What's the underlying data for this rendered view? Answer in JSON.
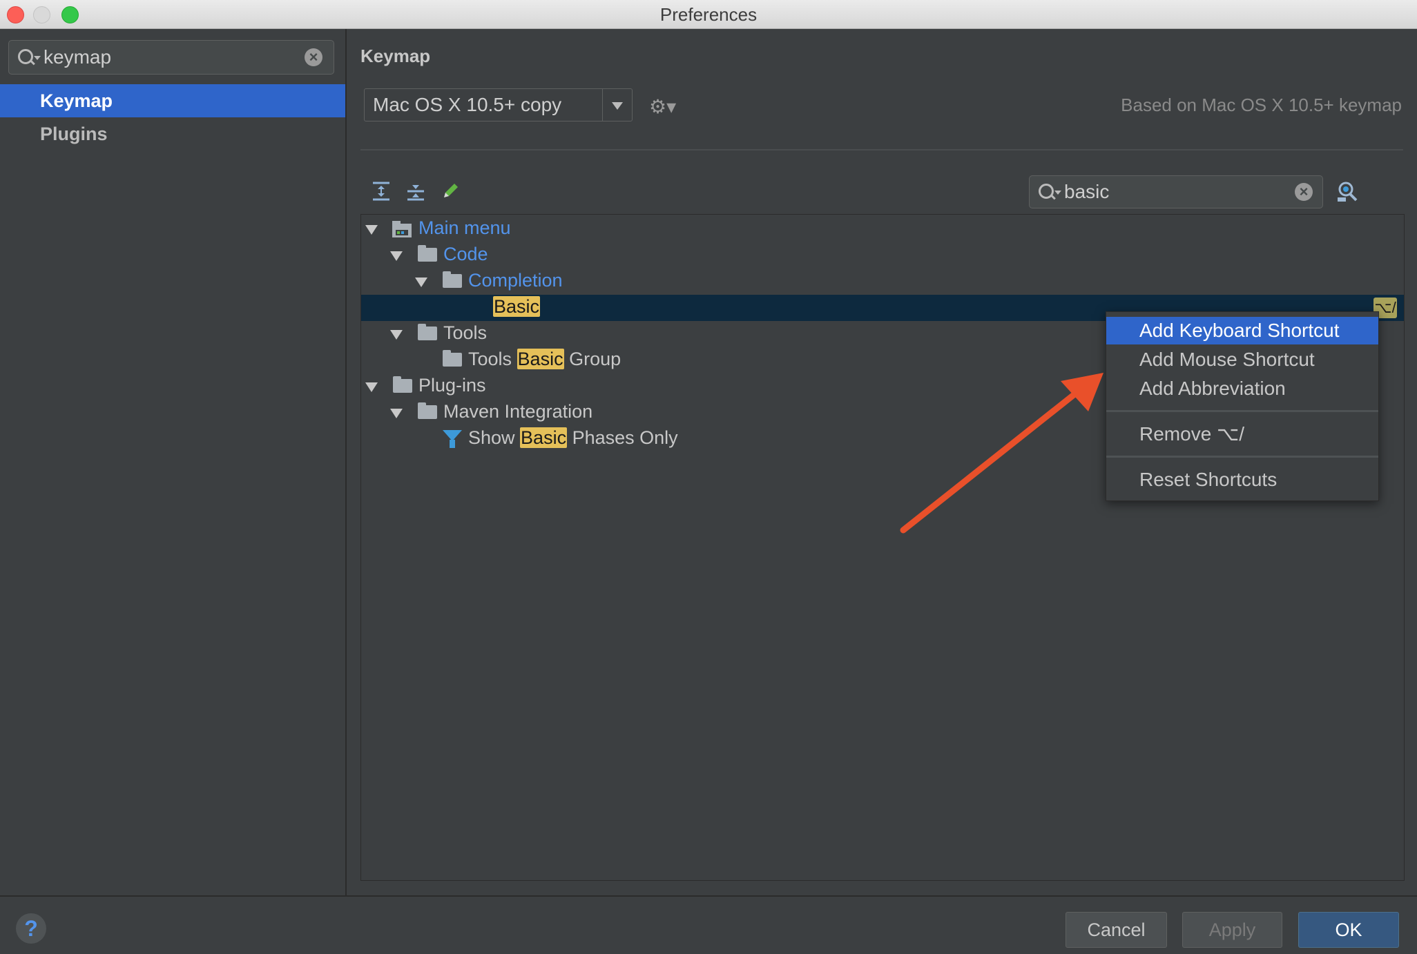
{
  "window": {
    "title": "Preferences"
  },
  "sidebar": {
    "search_value": "keymap",
    "items": [
      {
        "label": "Keymap",
        "active": true
      },
      {
        "label": "Plugins",
        "active": false
      }
    ]
  },
  "main": {
    "title": "Keymap",
    "keymap_select": "Mac OS X 10.5+ copy",
    "based_on": "Based on Mac OS X 10.5+ keymap",
    "filter_value": "basic",
    "tree": {
      "main_menu": "Main menu",
      "code": "Code",
      "completion": "Completion",
      "basic": "Basic",
      "basic_shortcut": "⌥/",
      "tools": "Tools",
      "tools_basic_group_pre": "Tools ",
      "tools_basic_group_hl": "Basic",
      "tools_basic_group_post": " Group",
      "plugins": "Plug-ins",
      "maven": "Maven Integration",
      "show_pre": "Show ",
      "show_hl": "Basic",
      "show_post": " Phases Only"
    }
  },
  "context_menu": {
    "add_keyboard": "Add Keyboard Shortcut",
    "add_mouse": "Add Mouse Shortcut",
    "add_abbrev": "Add Abbreviation",
    "remove": "Remove ⌥/",
    "reset": "Reset Shortcuts"
  },
  "footer": {
    "help": "?",
    "cancel": "Cancel",
    "apply": "Apply",
    "ok": "OK"
  },
  "colors": {
    "accent": "#2f65ca",
    "highlight": "#e5c059",
    "annotation_arrow": "#e9502a"
  }
}
